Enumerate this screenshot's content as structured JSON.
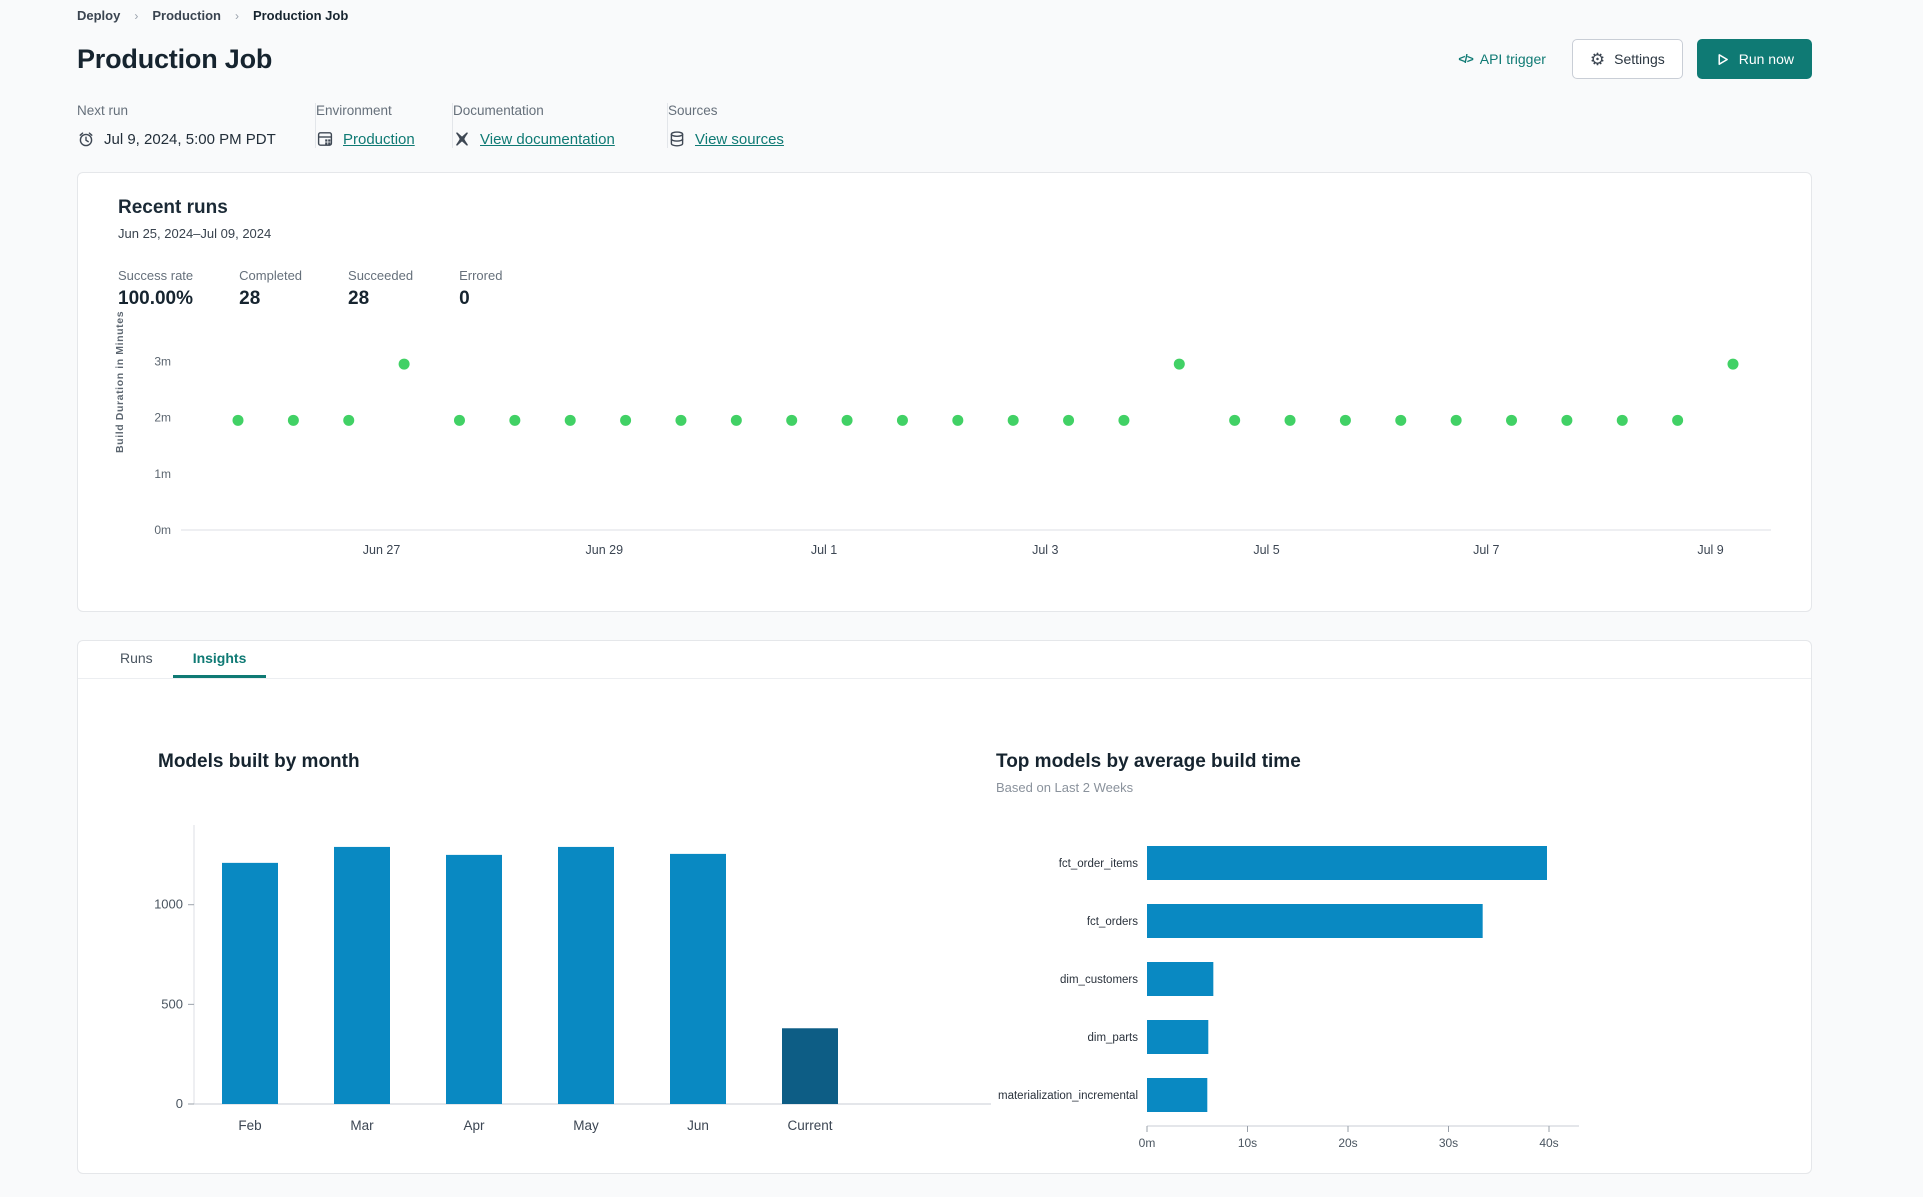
{
  "breadcrumb": {
    "items": [
      "Deploy",
      "Production",
      "Production Job"
    ],
    "separator": "›"
  },
  "header": {
    "title": "Production Job",
    "api_trigger_label": "API trigger",
    "settings_label": "Settings",
    "run_now_label": "Run now"
  },
  "icons": {
    "api_trigger": "</>",
    "settings": "⚙",
    "run_now": "play-outline",
    "next_run": "alarm-clock",
    "environment": "database-server",
    "documentation": "dbt-docs-x",
    "sources": "database-stack"
  },
  "meta": {
    "next_run": {
      "label": "Next run",
      "value": "Jul 9, 2024, 5:00 PM PDT"
    },
    "environment": {
      "label": "Environment",
      "value": "Production"
    },
    "documentation": {
      "label": "Documentation",
      "value": "View documentation"
    },
    "sources": {
      "label": "Sources",
      "value": "View sources"
    }
  },
  "recent_runs": {
    "title": "Recent runs",
    "date_range": "Jun 25, 2024–Jul 09, 2024",
    "stats": [
      {
        "label": "Success rate",
        "value": "100.00%"
      },
      {
        "label": "Completed",
        "value": "28"
      },
      {
        "label": "Succeeded",
        "value": "28"
      },
      {
        "label": "Errored",
        "value": "0"
      }
    ]
  },
  "tabs": [
    {
      "label": "Runs",
      "active": false
    },
    {
      "label": "Insights",
      "active": true
    }
  ],
  "colors": {
    "accent_teal": "#0f7a74",
    "dot_green": "#41d165",
    "bar_blue": "#0989c2",
    "bar_dark_blue": "#0d5d85"
  },
  "chart_data": [
    {
      "id": "build-duration-scatter",
      "type": "scatter",
      "ylabel": "Build Duration in Minutes",
      "point_color": "#41d165",
      "ylim": [
        0,
        3.2
      ],
      "y_ticks": [
        {
          "label": "0m",
          "value": 0
        },
        {
          "label": "1m",
          "value": 1
        },
        {
          "label": "2m",
          "value": 2
        },
        {
          "label": "3m",
          "value": 3
        }
      ],
      "x_ticks": [
        {
          "label": "Jun 27",
          "pos": 0.096
        },
        {
          "label": "Jun 29",
          "pos": 0.245
        },
        {
          "label": "Jul 1",
          "pos": 0.392
        },
        {
          "label": "Jul 3",
          "pos": 0.54
        },
        {
          "label": "Jul 5",
          "pos": 0.688
        },
        {
          "label": "Jul 7",
          "pos": 0.835
        },
        {
          "label": "Jul 9",
          "pos": 0.985
        }
      ],
      "points_minutes": [
        1.95,
        1.95,
        1.95,
        2.95,
        1.95,
        1.95,
        1.95,
        1.95,
        1.95,
        1.95,
        1.95,
        1.95,
        1.95,
        1.95,
        1.95,
        1.95,
        1.95,
        2.95,
        1.95,
        1.95,
        1.95,
        1.95,
        1.95,
        1.95,
        1.95,
        1.95,
        1.95,
        2.95
      ]
    },
    {
      "id": "models-built-by-month",
      "type": "bar",
      "title": "Models built by month",
      "categories": [
        "Feb",
        "Mar",
        "Apr",
        "May",
        "Jun",
        "Current"
      ],
      "values": [
        1210,
        1290,
        1250,
        1290,
        1255,
        380
      ],
      "y_ticks": [
        0,
        500,
        1000
      ],
      "ylim": [
        0,
        1400
      ],
      "bar_color": "#0989c2",
      "highlight_category": "Current",
      "highlight_color": "#0d5d85"
    },
    {
      "id": "top-models-by-avg-build-time",
      "type": "bar-horizontal",
      "title": "Top models by average build time",
      "subtitle": "Based on Last 2 Weeks",
      "categories": [
        "fct_order_items",
        "fct_orders",
        "dim_customers",
        "dim_parts",
        "materialization_incremental"
      ],
      "values_seconds": [
        39.8,
        33.4,
        6.6,
        6.1,
        6.0
      ],
      "x_ticks": [
        {
          "label": "0m",
          "value": 0
        },
        {
          "label": "10s",
          "value": 10
        },
        {
          "label": "20s",
          "value": 20
        },
        {
          "label": "30s",
          "value": 30
        },
        {
          "label": "40s",
          "value": 40
        }
      ],
      "xlim": [
        0,
        44
      ],
      "bar_color": "#0989c2"
    }
  ]
}
